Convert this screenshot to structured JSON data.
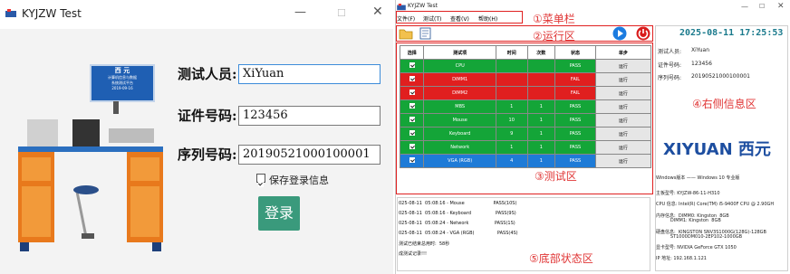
{
  "login": {
    "title": "KYJZW Test",
    "ctrl_min": "—",
    "ctrl_max": "☐",
    "ctrl_close": "✕",
    "image_banner": [
      "西 元",
      "计算机信息与数据",
      "系统测试平台",
      "2019-09-16"
    ],
    "tester_label": "测试人员:",
    "tester_value": "XiYuan",
    "cert_label": "证件号码:",
    "cert_value": "123456",
    "serial_label": "序列号码:",
    "serial_value": "20190521000100001",
    "save_label": "保存登录信息",
    "login_btn": "登录"
  },
  "main": {
    "title": "KYJZW Test",
    "ctrl_min": "—",
    "ctrl_max": "☐",
    "ctrl_close": "✕",
    "menu": [
      "文件(F)",
      "测试(T)",
      "查看(V)",
      "帮助(H)"
    ],
    "annotations": {
      "menubar": "①菜单栏",
      "run": "②运行区",
      "test": "③测试区",
      "right": "④右侧信息区",
      "bottom": "⑤底部状态区"
    },
    "table": {
      "headers": [
        "选择",
        "测试项",
        "时间",
        "次数",
        "状态",
        "单步"
      ],
      "rows": [
        {
          "name": "CPU",
          "time": "",
          "count": "",
          "status": "PASS",
          "action": "运行",
          "color": "#14a538"
        },
        {
          "name": "DIMM1",
          "time": "",
          "count": "",
          "status": "FAIL",
          "action": "运行",
          "color": "#e01f1f"
        },
        {
          "name": "DIMM2",
          "time": "",
          "count": "",
          "status": "FAIL",
          "action": "运行",
          "color": "#e01f1f"
        },
        {
          "name": "MBS",
          "time": "1",
          "count": "1",
          "status": "PASS",
          "action": "运行",
          "color": "#14a538"
        },
        {
          "name": "Mouse",
          "time": "10",
          "count": "1",
          "status": "PASS",
          "action": "运行",
          "color": "#14a538"
        },
        {
          "name": "Keyboard",
          "time": "9",
          "count": "1",
          "status": "PASS",
          "action": "运行",
          "color": "#14a538"
        },
        {
          "name": "Network",
          "time": "1",
          "count": "1",
          "status": "PASS",
          "action": "运行",
          "color": "#14a538"
        },
        {
          "name": "VGA (RGB)",
          "time": "4",
          "count": "1",
          "status": "PASS",
          "action": "运行",
          "color": "#1e7bd7"
        }
      ]
    },
    "log": [
      "025-08-11  05:08:16 - Mouse                    PASS(10S)",
      "025-08-11  05:08:16 - Keyboard                 PASS(9S)",
      "025-08-11  05:08:24 - Network                  PASS(1S)",
      "025-08-11  05:08:24 - VGA (RGB)                PASS(4S)",
      "测试已结束总用时:  58秒",
      "成测试记录!!!"
    ],
    "info": {
      "datetime": "2025-08-11  17:25:53",
      "tester_k": "测试人员:",
      "tester_v": "XiYuan",
      "cert_k": "证件号码:",
      "cert_v": "123456",
      "serial_k": "序列号码:",
      "serial_v": "20190521000100001",
      "logo": "XIYUAN 西元",
      "win_line": "Windows版本  ——  Windows 10 专业版",
      "board": "主板型号:  KYJZW-86-11-H310",
      "cpu": "CPU 信息:  Intel(R) Core(TM) i5-9400F CPU @ 2.90GH",
      "mem1": "内存信息:  DIMM0: Kingston  8GB",
      "mem2": "          DIMM1: Kingston  8GB",
      "disk1": "硬盘信息:  KINGSTON SNV3S1000G(128G)-128GB",
      "disk2": "          ST1000DM010-2EP102-1000GB",
      "gpu": "显卡型号:  NVIDIA GeForce GTX 1050",
      "ip": "IP  地址:  192.168.1.121"
    }
  }
}
